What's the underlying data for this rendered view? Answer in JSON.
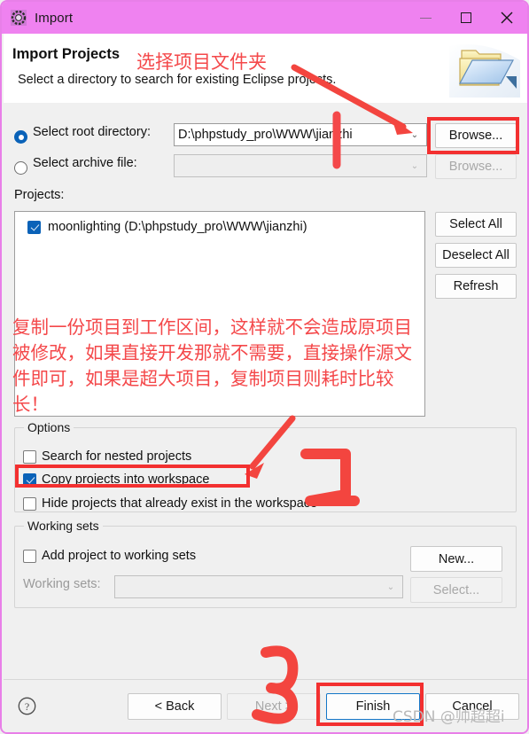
{
  "window": {
    "title": "Import",
    "icon": "eclipse-import-icon",
    "minimize_label": "–",
    "maximize_label": "□",
    "close_label": "✕"
  },
  "header": {
    "title": "Import Projects",
    "subtitle": "Select a directory to search for existing Eclipse projects.",
    "icon": "import-folder-icon"
  },
  "source": {
    "root_directory_label": "Select root directory:",
    "root_directory_value": "D:\\phpstudy_pro\\WWW\\jianzhi",
    "archive_label": "Select archive file:",
    "archive_value": "",
    "browse_root_label": "Browse...",
    "browse_archive_label": "Browse..."
  },
  "projects": {
    "label": "Projects:",
    "items": [
      {
        "name": "moonlighting (D:\\phpstudy_pro\\WWW\\jianzhi)",
        "checked": true
      }
    ],
    "select_all_label": "Select All",
    "deselect_all_label": "Deselect All",
    "refresh_label": "Refresh"
  },
  "options": {
    "group_title": "Options",
    "items": [
      {
        "label": "Search for nested projects",
        "checked": false
      },
      {
        "label": "Copy projects into workspace",
        "checked": true
      },
      {
        "label": "Hide projects that already exist in the workspace",
        "checked": false
      }
    ]
  },
  "working_sets": {
    "group_title": "Working sets",
    "add_label": "Add project to working sets",
    "add_checked": false,
    "sets_label": "Working sets:",
    "sets_value": "",
    "new_label": "New...",
    "select_label": "Select..."
  },
  "footer": {
    "help_icon": "help-icon",
    "back_label": "< Back",
    "next_label": "Next >",
    "finish_label": "Finish",
    "cancel_label": "Cancel"
  },
  "annotations": {
    "title_note": "选择项目文件夹",
    "paragraph": "复制一份项目到工作区间，这样就不会造成原项目被修改，如果直接开发那就不需要，直接操作源文件即可，如果是超大项目，复制项目则耗时比较长！",
    "step_2": "2",
    "step_3": "3",
    "watermark": "CSDN @帅超超i",
    "accent_color": "#f33030"
  }
}
